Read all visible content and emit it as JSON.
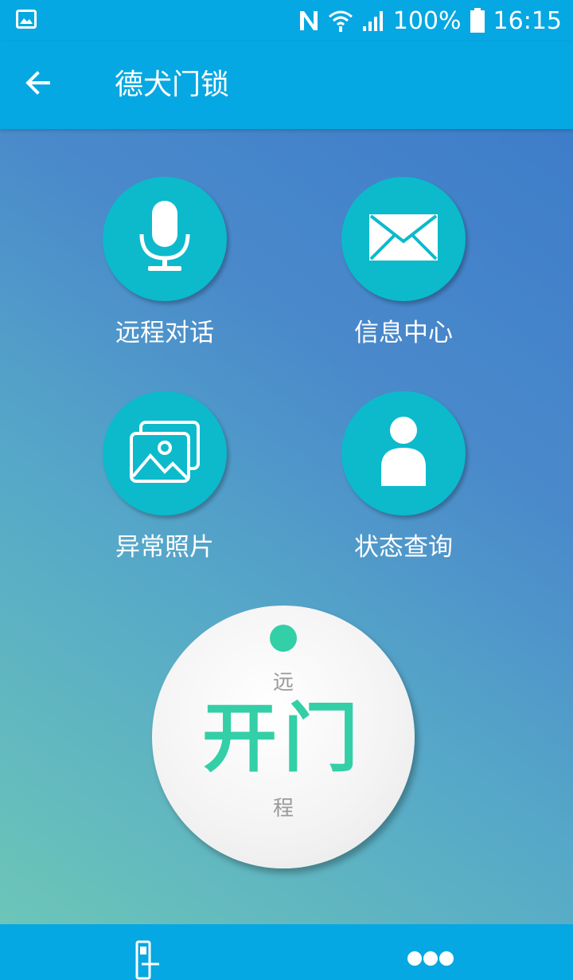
{
  "status_bar": {
    "battery": "100%",
    "time": "16:15",
    "icons": [
      "gallery-notification-icon",
      "nfc-icon",
      "wifi-icon",
      "signal-icon",
      "battery-icon"
    ]
  },
  "toolbar": {
    "title": "德犬门锁",
    "back_icon": "arrow-left-icon"
  },
  "features": [
    {
      "label": "远程对话",
      "icon": "microphone-icon"
    },
    {
      "label": "信息中心",
      "icon": "envelope-icon"
    },
    {
      "label": "异常照片",
      "icon": "photos-icon"
    },
    {
      "label": "状态查询",
      "icon": "person-icon"
    }
  ],
  "open_button": {
    "top_text": "远",
    "main_text": "开门",
    "bottom_text": "程"
  },
  "bottom_nav": {
    "items": [
      "door-lock-icon",
      "more-dots-icon"
    ]
  },
  "colors": {
    "primary": "#05a8e2",
    "feature_circle": "#0cbacc",
    "accent_green": "#33cfa6",
    "gray_text": "#9a9a9a"
  }
}
